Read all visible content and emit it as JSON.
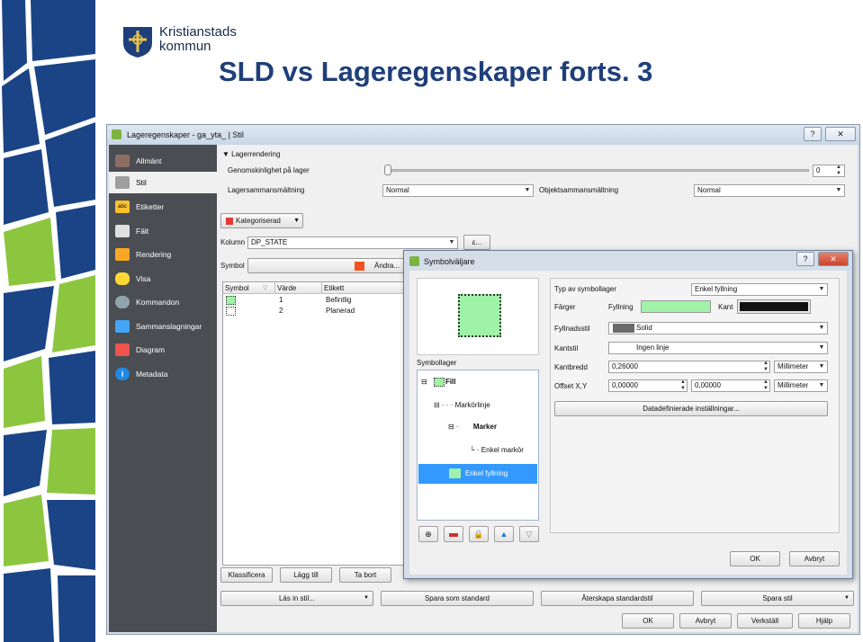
{
  "slide": {
    "title": "SLD vs Lageregenskaper forts. 3",
    "logo_line1": "Kristianstads",
    "logo_line2": "kommun"
  },
  "colors": {
    "slide_title": "#1e3f7a",
    "deco_blue": "#1a4486",
    "deco_green": "#8cc63f",
    "swatch_fill": "#9ff2a8",
    "sidebar": "#4a4d52"
  },
  "window": {
    "title": "Lageregenskaper - ga_yta_ | Stil",
    "help_btn": "?",
    "close_btn": "✕",
    "sidebar": [
      "Allmänt",
      "Stil",
      "Etiketter",
      "Fält",
      "Rendering",
      "Visa",
      "Kommandon",
      "Sammanslagningar",
      "Diagram",
      "Metadata"
    ],
    "sidebar_selected": "Stil",
    "section_title": "Lagerrendering",
    "opacity_label": "Genomskinlighet på lager",
    "opacity_value": "0",
    "layer_blend_label": "Lagersammansmältning",
    "layer_blend_value": "Normal",
    "feature_blend_label": "Objektsammansmältning",
    "feature_blend_value": "Normal",
    "renderer": "Kategoriserad",
    "column_label": "Kolumn",
    "column_value": "DP_STATE",
    "expr_btn": "ε...",
    "symbol_label": "Symbol",
    "change_btn": "Ändra...",
    "table_headers": [
      "Symbol",
      "Värde",
      "Etikett"
    ],
    "table_rows": [
      {
        "value": "1",
        "label": "Befintlig"
      },
      {
        "value": "2",
        "label": "Planerad"
      }
    ],
    "classify_btn": "Klassificera",
    "add_btn": "Lägg till",
    "delete_btn": "Ta bort",
    "load_style_btn": "Läs in stil...",
    "save_default_btn": "Spara som standard",
    "restore_default_btn": "Återskapa standardstil",
    "save_style_btn": "Spara stil",
    "ok_btn": "OK",
    "cancel_btn": "Avbryt",
    "apply_btn": "Verkställ",
    "help_btn_bottom": "Hjälp"
  },
  "dialog": {
    "title": "Symbolväljare",
    "help_btn": "?",
    "close_btn": "✕",
    "symbol_layers_label": "Symbollager",
    "tree": [
      "Fill",
      "Markörlinje",
      "Marker",
      "Enkel markör",
      "Enkel fyllning"
    ],
    "layer_type_label": "Typ av symbollager",
    "layer_type_value": "Enkel fyllning",
    "colors_label": "Färger",
    "fill_label": "Fyllning",
    "border_label": "Kant",
    "fill_style_label": "Fyllnadsstil",
    "fill_style_value": "Solid",
    "border_style_label": "Kantstil",
    "border_style_value": "Ingen linje",
    "border_width_label": "Kantbredd",
    "border_width_value": "0,26000",
    "border_width_unit": "Millimeter",
    "offset_label": "Offset X,Y",
    "offset_x": "0,00000",
    "offset_y": "0,00000",
    "offset_unit": "Millimeter",
    "data_defined_btn": "Datadefinierade inställningar...",
    "ok_btn": "OK",
    "cancel_btn": "Avbryt"
  }
}
